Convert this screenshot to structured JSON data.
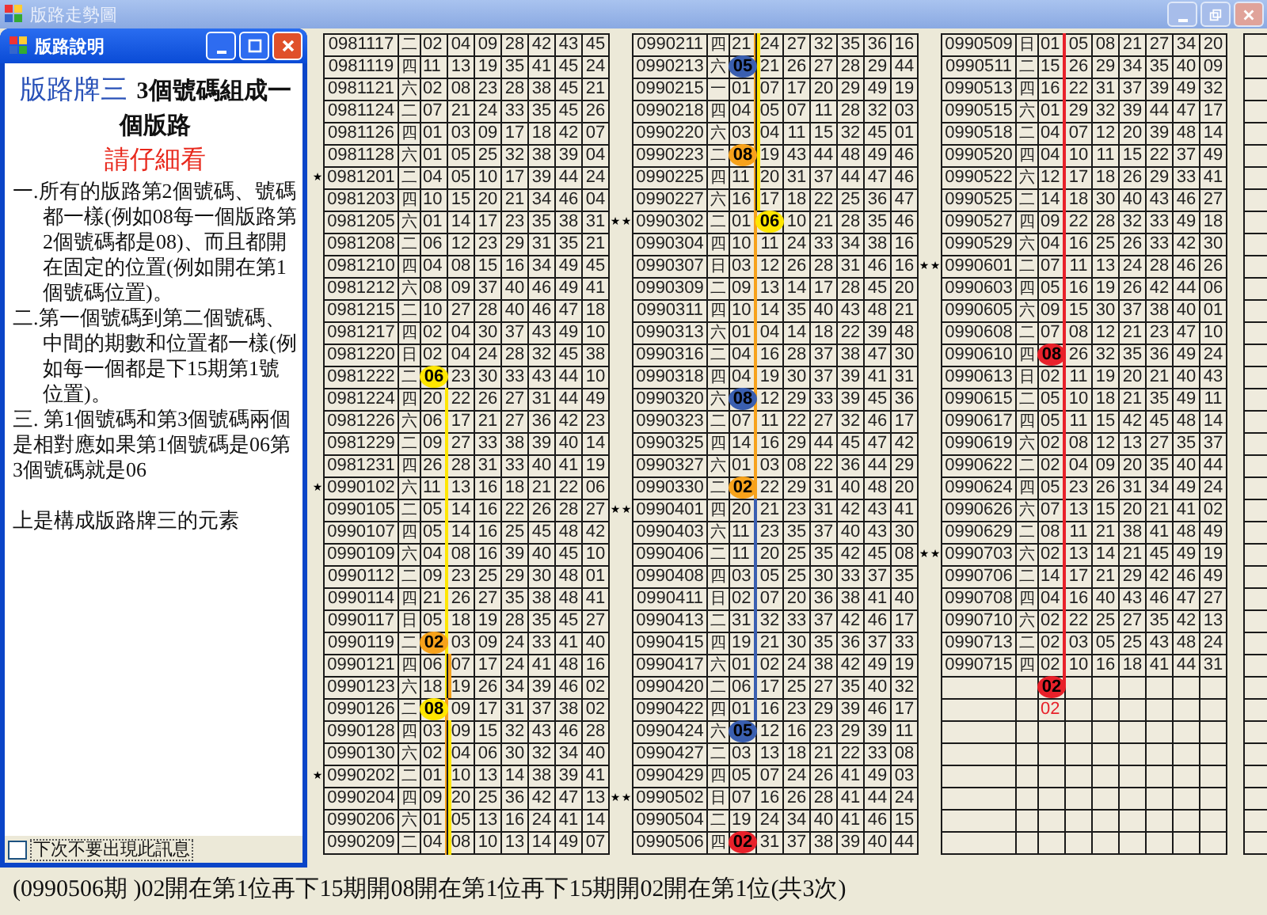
{
  "window": {
    "title": "版路走勢圖"
  },
  "dialog": {
    "title": "版路說明",
    "heading": {
      "label": "版路牌三",
      "text": "3個號碼組成一個版路"
    },
    "notice": "請仔細看",
    "paragraphs": [
      {
        "kind": "hanging",
        "text": "一.所有的版路第2個號碼、號碼都一樣(例如08每一個版路第2個號碼都是08)、而且都開在固定的位置(例如開在第1個號碼位置)。"
      },
      {
        "kind": "hanging",
        "text": "二.第一個號碼到第二個號碼、中間的期數和位置都一樣(例如每一個都是下15期第1號位置)。"
      },
      {
        "kind": "plain",
        "text": "三. 第1個號碼和第3個號碼兩個是相對應如果第1個號碼是06第3個號碼就是06"
      },
      {
        "kind": "closing",
        "text": "上是構成版路牌三的元素"
      }
    ],
    "checkbox": {
      "label": "下次不要出現此訊息",
      "checked": false
    }
  },
  "blocks": [
    {
      "rows": [
        {
          "period": "0981117",
          "day": "二",
          "numbers": [
            "02",
            "04",
            "09",
            "28",
            "42",
            "43",
            "45"
          ]
        },
        {
          "period": "0981119",
          "day": "四",
          "numbers": [
            "11",
            "13",
            "19",
            "35",
            "41",
            "45",
            "24"
          ]
        },
        {
          "period": "0981121",
          "day": "六",
          "numbers": [
            "02",
            "08",
            "23",
            "28",
            "38",
            "45",
            "21"
          ]
        },
        {
          "period": "0981124",
          "day": "二",
          "numbers": [
            "07",
            "21",
            "24",
            "33",
            "35",
            "45",
            "26"
          ]
        },
        {
          "period": "0981126",
          "day": "四",
          "numbers": [
            "01",
            "03",
            "09",
            "17",
            "18",
            "42",
            "07"
          ]
        },
        {
          "period": "0981128",
          "day": "六",
          "numbers": [
            "01",
            "05",
            "25",
            "32",
            "38",
            "39",
            "04"
          ]
        },
        {
          "period": "0981201",
          "day": "二",
          "numbers": [
            "04",
            "05",
            "10",
            "17",
            "39",
            "44",
            "24"
          ],
          "star_left": "★"
        },
        {
          "period": "0981203",
          "day": "四",
          "numbers": [
            "10",
            "15",
            "20",
            "21",
            "34",
            "46",
            "04"
          ]
        },
        {
          "period": "0981205",
          "day": "六",
          "numbers": [
            "01",
            "14",
            "17",
            "23",
            "35",
            "38",
            "31"
          ],
          "star_right": "★"
        },
        {
          "period": "0981208",
          "day": "二",
          "numbers": [
            "06",
            "12",
            "23",
            "29",
            "31",
            "35",
            "21"
          ]
        },
        {
          "period": "0981210",
          "day": "四",
          "numbers": [
            "04",
            "08",
            "15",
            "16",
            "34",
            "49",
            "45"
          ]
        },
        {
          "period": "0981212",
          "day": "六",
          "numbers": [
            "08",
            "09",
            "37",
            "40",
            "46",
            "49",
            "41"
          ]
        },
        {
          "period": "0981215",
          "day": "二",
          "numbers": [
            "10",
            "27",
            "28",
            "40",
            "46",
            "47",
            "18"
          ]
        },
        {
          "period": "0981217",
          "day": "四",
          "numbers": [
            "02",
            "04",
            "30",
            "37",
            "43",
            "49",
            "10"
          ]
        },
        {
          "period": "0981220",
          "day": "日",
          "numbers": [
            "02",
            "04",
            "24",
            "28",
            "32",
            "45",
            "38"
          ]
        },
        {
          "period": "0981222",
          "day": "二",
          "numbers": [
            {
              "text": "06",
              "color": "#ffe600"
            },
            "23",
            "30",
            "33",
            "43",
            "44",
            "10"
          ]
        },
        {
          "period": "0981224",
          "day": "四",
          "numbers": [
            "20",
            "22",
            "26",
            "27",
            "31",
            "44",
            "49"
          ],
          "traces": [
            {
              "color": "#ffe600"
            }
          ]
        },
        {
          "period": "0981226",
          "day": "六",
          "numbers": [
            "06",
            "17",
            "21",
            "27",
            "36",
            "42",
            "23"
          ],
          "traces": [
            {
              "color": "#ffe600"
            }
          ]
        },
        {
          "period": "0981229",
          "day": "二",
          "numbers": [
            "09",
            "27",
            "33",
            "38",
            "39",
            "40",
            "14"
          ],
          "traces": [
            {
              "color": "#ffe600"
            }
          ]
        },
        {
          "period": "0981231",
          "day": "四",
          "numbers": [
            "26",
            "28",
            "31",
            "33",
            "40",
            "41",
            "19"
          ],
          "traces": [
            {
              "color": "#ffe600"
            }
          ]
        },
        {
          "period": "0990102",
          "day": "六",
          "numbers": [
            "11",
            "13",
            "16",
            "18",
            "21",
            "22",
            "06"
          ],
          "star_left": "★",
          "traces": [
            {
              "color": "#ffe600"
            }
          ]
        },
        {
          "period": "0990105",
          "day": "二",
          "numbers": [
            "05",
            "14",
            "16",
            "22",
            "26",
            "28",
            "27"
          ],
          "star_right": "★",
          "traces": [
            {
              "color": "#ffe600"
            }
          ]
        },
        {
          "period": "0990107",
          "day": "四",
          "numbers": [
            "05",
            "14",
            "16",
            "25",
            "45",
            "48",
            "42"
          ],
          "traces": [
            {
              "color": "#ffe600"
            }
          ]
        },
        {
          "period": "0990109",
          "day": "六",
          "numbers": [
            "04",
            "08",
            "16",
            "39",
            "40",
            "45",
            "10"
          ],
          "traces": [
            {
              "color": "#ffe600"
            }
          ]
        },
        {
          "period": "0990112",
          "day": "二",
          "numbers": [
            "09",
            "23",
            "25",
            "29",
            "30",
            "48",
            "01"
          ],
          "traces": [
            {
              "color": "#ffe600"
            }
          ]
        },
        {
          "period": "0990114",
          "day": "四",
          "numbers": [
            "21",
            "26",
            "27",
            "35",
            "38",
            "48",
            "41"
          ],
          "traces": [
            {
              "color": "#ffe600"
            }
          ]
        },
        {
          "period": "0990117",
          "day": "日",
          "numbers": [
            "05",
            "18",
            "19",
            "28",
            "35",
            "45",
            "27"
          ],
          "traces": [
            {
              "color": "#ffe600"
            }
          ]
        },
        {
          "period": "0990119",
          "day": "二",
          "numbers": [
            {
              "text": "02",
              "color": "#f7a21b"
            },
            "03",
            "09",
            "24",
            "33",
            "41",
            "40"
          ],
          "traces": [
            {
              "color": "#ffe600"
            }
          ]
        },
        {
          "period": "0990121",
          "day": "四",
          "numbers": [
            "06",
            "07",
            "17",
            "24",
            "41",
            "48",
            "16"
          ],
          "traces": [
            {
              "color": "#ffe600"
            },
            {
              "color": "#f7a21b"
            }
          ]
        },
        {
          "period": "0990123",
          "day": "六",
          "numbers": [
            "18",
            "19",
            "26",
            "34",
            "39",
            "46",
            "02"
          ],
          "traces": [
            {
              "color": "#ffe600"
            },
            {
              "color": "#f7a21b"
            }
          ]
        },
        {
          "period": "0990126",
          "day": "二",
          "numbers": [
            {
              "text": "08",
              "color": "#ffe600"
            },
            "09",
            "17",
            "31",
            "37",
            "38",
            "02"
          ],
          "traces": [
            {
              "color": "#f7a21b"
            }
          ]
        },
        {
          "period": "0990128",
          "day": "四",
          "numbers": [
            "03",
            "09",
            "15",
            "32",
            "43",
            "46",
            "28"
          ],
          "traces": [
            {
              "color": "#f7a21b"
            },
            {
              "color": "#ffe600"
            }
          ]
        },
        {
          "period": "0990130",
          "day": "六",
          "numbers": [
            "02",
            "04",
            "06",
            "30",
            "32",
            "34",
            "40"
          ],
          "traces": [
            {
              "color": "#f7a21b"
            },
            {
              "color": "#ffe600"
            }
          ]
        },
        {
          "period": "0990202",
          "day": "二",
          "numbers": [
            "01",
            "10",
            "13",
            "14",
            "38",
            "39",
            "41"
          ],
          "star_left": "★",
          "traces": [
            {
              "color": "#f7a21b"
            },
            {
              "color": "#ffe600"
            }
          ]
        },
        {
          "period": "0990204",
          "day": "四",
          "numbers": [
            "09",
            "20",
            "25",
            "36",
            "42",
            "47",
            "13"
          ],
          "star_right": "★",
          "traces": [
            {
              "color": "#f7a21b"
            },
            {
              "color": "#ffe600"
            }
          ]
        },
        {
          "period": "0990206",
          "day": "六",
          "numbers": [
            "01",
            "05",
            "13",
            "16",
            "24",
            "41",
            "14"
          ],
          "traces": [
            {
              "color": "#f7a21b"
            },
            {
              "color": "#ffe600"
            }
          ]
        },
        {
          "period": "0990209",
          "day": "二",
          "numbers": [
            "04",
            "08",
            "10",
            "13",
            "14",
            "49",
            "07"
          ],
          "traces": [
            {
              "color": "#f7a21b"
            },
            {
              "color": "#ffe600"
            }
          ]
        }
      ]
    },
    {
      "rows": [
        {
          "period": "0990211",
          "day": "四",
          "numbers": [
            "21",
            "24",
            "27",
            "32",
            "35",
            "36",
            "16"
          ],
          "traces": [
            {
              "color": "#f7a21b"
            },
            {
              "color": "#ffe600"
            }
          ]
        },
        {
          "period": "0990213",
          "day": "六",
          "numbers": [
            {
              "text": "05",
              "color": "#3a5fb0"
            },
            "21",
            "26",
            "27",
            "28",
            "29",
            "44"
          ],
          "traces": [
            {
              "color": "#f7a21b"
            },
            {
              "color": "#ffe600"
            }
          ]
        },
        {
          "period": "0990215",
          "day": "一",
          "numbers": [
            "01",
            "07",
            "17",
            "20",
            "29",
            "49",
            "19"
          ],
          "traces": [
            {
              "color": "#f7a21b"
            },
            {
              "color": "#ffe600"
            }
          ]
        },
        {
          "period": "0990218",
          "day": "四",
          "numbers": [
            "04",
            "05",
            "07",
            "11",
            "28",
            "32",
            "03"
          ],
          "traces": [
            {
              "color": "#f7a21b"
            },
            {
              "color": "#ffe600"
            }
          ]
        },
        {
          "period": "0990220",
          "day": "六",
          "numbers": [
            "03",
            "04",
            "11",
            "15",
            "32",
            "45",
            "01"
          ],
          "traces": [
            {
              "color": "#f7a21b"
            },
            {
              "color": "#ffe600"
            }
          ]
        },
        {
          "period": "0990223",
          "day": "二",
          "numbers": [
            {
              "text": "08",
              "color": "#f7a21b"
            },
            "19",
            "43",
            "44",
            "48",
            "49",
            "46"
          ],
          "traces": [
            {
              "color": "#f7a21b"
            },
            {
              "color": "#ffe600"
            }
          ]
        },
        {
          "period": "0990225",
          "day": "四",
          "numbers": [
            "11",
            "20",
            "31",
            "37",
            "44",
            "47",
            "46"
          ],
          "traces": [
            {
              "color": "#f7a21b"
            },
            {
              "color": "#ffe600"
            }
          ]
        },
        {
          "period": "0990227",
          "day": "六",
          "numbers": [
            "16",
            "17",
            "18",
            "22",
            "25",
            "36",
            "47"
          ],
          "traces": [
            {
              "color": "#f7a21b"
            },
            {
              "color": "#ffe600"
            }
          ]
        },
        {
          "period": "0990302",
          "day": "二",
          "numbers": [
            "01",
            {
              "text": "06",
              "color": "#ffe600"
            },
            "10",
            "21",
            "28",
            "35",
            "46"
          ],
          "star_left": "★",
          "traces": [
            {
              "color": "#f7a21b"
            }
          ]
        },
        {
          "period": "0990304",
          "day": "四",
          "numbers": [
            "10",
            "11",
            "24",
            "33",
            "34",
            "38",
            "16"
          ],
          "traces": [
            {
              "color": "#f7a21b"
            }
          ]
        },
        {
          "period": "0990307",
          "day": "日",
          "numbers": [
            "03",
            "12",
            "26",
            "28",
            "31",
            "46",
            "16"
          ],
          "star_right": "★",
          "traces": [
            {
              "color": "#f7a21b"
            }
          ]
        },
        {
          "period": "0990309",
          "day": "二",
          "numbers": [
            "09",
            "13",
            "14",
            "17",
            "28",
            "45",
            "20"
          ],
          "traces": [
            {
              "color": "#f7a21b"
            }
          ]
        },
        {
          "period": "0990311",
          "day": "四",
          "numbers": [
            "10",
            "14",
            "35",
            "40",
            "43",
            "48",
            "21"
          ],
          "traces": [
            {
              "color": "#f7a21b"
            }
          ]
        },
        {
          "period": "0990313",
          "day": "六",
          "numbers": [
            "01",
            "04",
            "14",
            "18",
            "22",
            "39",
            "48"
          ],
          "traces": [
            {
              "color": "#f7a21b"
            }
          ]
        },
        {
          "period": "0990316",
          "day": "二",
          "numbers": [
            "04",
            "16",
            "28",
            "37",
            "38",
            "47",
            "30"
          ],
          "traces": [
            {
              "color": "#f7a21b"
            }
          ]
        },
        {
          "period": "0990318",
          "day": "四",
          "numbers": [
            "04",
            "19",
            "30",
            "37",
            "39",
            "41",
            "31"
          ],
          "traces": [
            {
              "color": "#f7a21b"
            }
          ]
        },
        {
          "period": "0990320",
          "day": "六",
          "numbers": [
            {
              "text": "08",
              "color": "#3a5fb0"
            },
            "12",
            "29",
            "33",
            "39",
            "45",
            "36"
          ],
          "traces": [
            {
              "color": "#f7a21b"
            }
          ]
        },
        {
          "period": "0990323",
          "day": "二",
          "numbers": [
            "07",
            "11",
            "22",
            "27",
            "32",
            "46",
            "17"
          ],
          "traces": [
            {
              "color": "#f7a21b"
            }
          ]
        },
        {
          "period": "0990325",
          "day": "四",
          "numbers": [
            "14",
            "16",
            "29",
            "44",
            "45",
            "47",
            "42"
          ],
          "traces": [
            {
              "color": "#f7a21b"
            }
          ]
        },
        {
          "period": "0990327",
          "day": "六",
          "numbers": [
            "01",
            "03",
            "08",
            "22",
            "36",
            "44",
            "29"
          ],
          "traces": [
            {
              "color": "#f7a21b"
            }
          ]
        },
        {
          "period": "0990330",
          "day": "二",
          "numbers": [
            {
              "text": "02",
              "color": "#f7a21b"
            },
            "22",
            "29",
            "31",
            "40",
            "48",
            "20"
          ],
          "traces": [
            {
              "color": "#f7a21b"
            }
          ]
        },
        {
          "period": "0990401",
          "day": "四",
          "numbers": [
            "20",
            "21",
            "23",
            "31",
            "42",
            "43",
            "41"
          ],
          "star_left": "★",
          "traces": [
            {
              "color": "#3a5fb0"
            }
          ]
        },
        {
          "period": "0990403",
          "day": "六",
          "numbers": [
            "11",
            "23",
            "35",
            "37",
            "40",
            "43",
            "30"
          ],
          "traces": [
            {
              "color": "#3a5fb0"
            }
          ]
        },
        {
          "period": "0990406",
          "day": "二",
          "numbers": [
            "11",
            "20",
            "25",
            "35",
            "42",
            "45",
            "08"
          ],
          "star_right": "★",
          "traces": [
            {
              "color": "#3a5fb0"
            }
          ]
        },
        {
          "period": "0990408",
          "day": "四",
          "numbers": [
            "03",
            "05",
            "25",
            "30",
            "33",
            "37",
            "35"
          ],
          "traces": [
            {
              "color": "#3a5fb0"
            }
          ]
        },
        {
          "period": "0990411",
          "day": "日",
          "numbers": [
            "02",
            "07",
            "20",
            "36",
            "38",
            "41",
            "40"
          ],
          "traces": [
            {
              "color": "#3a5fb0"
            }
          ]
        },
        {
          "period": "0990413",
          "day": "二",
          "numbers": [
            "31",
            "32",
            "33",
            "37",
            "42",
            "46",
            "17"
          ],
          "traces": [
            {
              "color": "#3a5fb0"
            }
          ]
        },
        {
          "period": "0990415",
          "day": "四",
          "numbers": [
            "19",
            "21",
            "30",
            "35",
            "36",
            "37",
            "33"
          ],
          "traces": [
            {
              "color": "#3a5fb0"
            }
          ]
        },
        {
          "period": "0990417",
          "day": "六",
          "numbers": [
            "01",
            "02",
            "24",
            "38",
            "42",
            "49",
            "19"
          ],
          "traces": [
            {
              "color": "#3a5fb0"
            }
          ]
        },
        {
          "period": "0990420",
          "day": "二",
          "numbers": [
            "06",
            "17",
            "25",
            "27",
            "35",
            "40",
            "32"
          ],
          "traces": [
            {
              "color": "#3a5fb0"
            }
          ]
        },
        {
          "period": "0990422",
          "day": "四",
          "numbers": [
            "01",
            "16",
            "23",
            "29",
            "39",
            "46",
            "17"
          ],
          "traces": [
            {
              "color": "#3a5fb0"
            }
          ]
        },
        {
          "period": "0990424",
          "day": "六",
          "numbers": [
            {
              "text": "05",
              "color": "#3a5fb0"
            },
            "12",
            "16",
            "23",
            "29",
            "39",
            "11"
          ]
        },
        {
          "period": "0990427",
          "day": "二",
          "numbers": [
            "03",
            "13",
            "18",
            "21",
            "22",
            "33",
            "08"
          ]
        },
        {
          "period": "0990429",
          "day": "四",
          "numbers": [
            "05",
            "07",
            "24",
            "26",
            "41",
            "49",
            "03"
          ]
        },
        {
          "period": "0990502",
          "day": "日",
          "numbers": [
            "07",
            "16",
            "26",
            "28",
            "41",
            "44",
            "24"
          ],
          "star_left": "★"
        },
        {
          "period": "0990504",
          "day": "二",
          "numbers": [
            "19",
            "24",
            "34",
            "40",
            "41",
            "46",
            "15"
          ]
        },
        {
          "period": "0990506",
          "day": "四",
          "numbers": [
            {
              "text": "02",
              "color": "#e8212a"
            },
            "31",
            "37",
            "38",
            "39",
            "40",
            "44"
          ]
        }
      ]
    },
    {
      "rows": [
        {
          "period": "0990509",
          "day": "日",
          "numbers": [
            "01",
            "05",
            "08",
            "21",
            "27",
            "34",
            "20"
          ],
          "traces": [
            {
              "color": "#e8212a"
            }
          ]
        },
        {
          "period": "0990511",
          "day": "二",
          "numbers": [
            "15",
            "26",
            "29",
            "34",
            "35",
            "40",
            "09"
          ],
          "traces": [
            {
              "color": "#e8212a"
            }
          ]
        },
        {
          "period": "0990513",
          "day": "四",
          "numbers": [
            "16",
            "22",
            "31",
            "37",
            "39",
            "49",
            "32"
          ],
          "traces": [
            {
              "color": "#e8212a"
            }
          ]
        },
        {
          "period": "0990515",
          "day": "六",
          "numbers": [
            "01",
            "29",
            "32",
            "39",
            "44",
            "47",
            "17"
          ],
          "traces": [
            {
              "color": "#e8212a"
            }
          ]
        },
        {
          "period": "0990518",
          "day": "二",
          "numbers": [
            "04",
            "07",
            "12",
            "20",
            "39",
            "48",
            "14"
          ],
          "traces": [
            {
              "color": "#e8212a"
            }
          ]
        },
        {
          "period": "0990520",
          "day": "四",
          "numbers": [
            "04",
            "10",
            "11",
            "15",
            "22",
            "37",
            "49"
          ],
          "traces": [
            {
              "color": "#e8212a"
            }
          ]
        },
        {
          "period": "0990522",
          "day": "六",
          "numbers": [
            "12",
            "17",
            "18",
            "26",
            "29",
            "33",
            "41"
          ],
          "traces": [
            {
              "color": "#e8212a"
            }
          ]
        },
        {
          "period": "0990525",
          "day": "二",
          "numbers": [
            "14",
            "18",
            "30",
            "40",
            "43",
            "46",
            "27"
          ],
          "traces": [
            {
              "color": "#e8212a"
            }
          ]
        },
        {
          "period": "0990527",
          "day": "四",
          "numbers": [
            "09",
            "22",
            "28",
            "32",
            "33",
            "49",
            "18"
          ],
          "traces": [
            {
              "color": "#e8212a"
            }
          ]
        },
        {
          "period": "0990529",
          "day": "六",
          "numbers": [
            "04",
            "16",
            "25",
            "26",
            "33",
            "42",
            "30"
          ],
          "traces": [
            {
              "color": "#e8212a"
            }
          ]
        },
        {
          "period": "0990601",
          "day": "二",
          "numbers": [
            "07",
            "11",
            "13",
            "24",
            "28",
            "46",
            "26"
          ],
          "star_left": "★",
          "traces": [
            {
              "color": "#e8212a"
            }
          ]
        },
        {
          "period": "0990603",
          "day": "四",
          "numbers": [
            "05",
            "16",
            "19",
            "26",
            "42",
            "44",
            "06"
          ],
          "traces": [
            {
              "color": "#e8212a"
            }
          ]
        },
        {
          "period": "0990605",
          "day": "六",
          "numbers": [
            "09",
            "15",
            "30",
            "37",
            "38",
            "40",
            "01"
          ],
          "traces": [
            {
              "color": "#e8212a"
            }
          ]
        },
        {
          "period": "0990608",
          "day": "二",
          "numbers": [
            "07",
            "08",
            "12",
            "21",
            "23",
            "47",
            "10"
          ],
          "traces": [
            {
              "color": "#e8212a"
            }
          ]
        },
        {
          "period": "0990610",
          "day": "四",
          "numbers": [
            {
              "text": "08",
              "color": "#e8212a"
            },
            "26",
            "32",
            "35",
            "36",
            "49",
            "24"
          ],
          "traces": [
            {
              "color": "#e8212a"
            }
          ]
        },
        {
          "period": "0990613",
          "day": "日",
          "numbers": [
            "02",
            "11",
            "19",
            "20",
            "21",
            "40",
            "43"
          ],
          "traces": [
            {
              "color": "#e8212a"
            }
          ]
        },
        {
          "period": "0990615",
          "day": "二",
          "numbers": [
            "05",
            "10",
            "18",
            "21",
            "35",
            "49",
            "11"
          ],
          "traces": [
            {
              "color": "#e8212a"
            }
          ]
        },
        {
          "period": "0990617",
          "day": "四",
          "numbers": [
            "05",
            "11",
            "15",
            "42",
            "45",
            "48",
            "14"
          ],
          "traces": [
            {
              "color": "#e8212a"
            }
          ]
        },
        {
          "period": "0990619",
          "day": "六",
          "numbers": [
            "02",
            "08",
            "12",
            "13",
            "27",
            "35",
            "37"
          ],
          "traces": [
            {
              "color": "#e8212a"
            }
          ]
        },
        {
          "period": "0990622",
          "day": "二",
          "numbers": [
            "02",
            "04",
            "09",
            "20",
            "35",
            "40",
            "44"
          ],
          "traces": [
            {
              "color": "#e8212a"
            }
          ]
        },
        {
          "period": "0990624",
          "day": "四",
          "numbers": [
            "05",
            "23",
            "26",
            "31",
            "34",
            "49",
            "24"
          ],
          "traces": [
            {
              "color": "#e8212a"
            }
          ]
        },
        {
          "period": "0990626",
          "day": "六",
          "numbers": [
            "07",
            "13",
            "15",
            "20",
            "21",
            "41",
            "02"
          ],
          "traces": [
            {
              "color": "#e8212a"
            }
          ]
        },
        {
          "period": "0990629",
          "day": "二",
          "numbers": [
            "08",
            "11",
            "21",
            "38",
            "41",
            "48",
            "49"
          ],
          "traces": [
            {
              "color": "#e8212a"
            }
          ]
        },
        {
          "period": "0990703",
          "day": "六",
          "numbers": [
            "02",
            "13",
            "14",
            "21",
            "45",
            "49",
            "19"
          ],
          "star_left": "★",
          "traces": [
            {
              "color": "#e8212a"
            }
          ]
        },
        {
          "period": "0990706",
          "day": "二",
          "numbers": [
            "14",
            "17",
            "21",
            "29",
            "42",
            "46",
            "49"
          ],
          "traces": [
            {
              "color": "#e8212a"
            }
          ]
        },
        {
          "period": "0990708",
          "day": "四",
          "numbers": [
            "04",
            "16",
            "40",
            "43",
            "46",
            "47",
            "27"
          ],
          "traces": [
            {
              "color": "#e8212a"
            }
          ]
        },
        {
          "period": "0990710",
          "day": "六",
          "numbers": [
            "02",
            "22",
            "25",
            "27",
            "35",
            "42",
            "13"
          ],
          "traces": [
            {
              "color": "#e8212a"
            }
          ]
        },
        {
          "period": "0990713",
          "day": "二",
          "numbers": [
            "02",
            "03",
            "05",
            "25",
            "43",
            "48",
            "24"
          ],
          "traces": [
            {
              "color": "#e8212a"
            }
          ]
        },
        {
          "period": "0990715",
          "day": "四",
          "numbers": [
            "02",
            "10",
            "16",
            "18",
            "41",
            "44",
            "31"
          ],
          "traces": [
            {
              "color": "#e8212a"
            }
          ]
        }
      ],
      "extra_rows": [
        {
          "kind": "forecast",
          "number": "02",
          "color": "#e8212a",
          "traces": [
            {
              "color": "#e8212a"
            }
          ]
        },
        {
          "kind": "note",
          "number": "02",
          "color": "#e8212a"
        }
      ]
    }
  ],
  "status": "(0990506期 )02開在第1位再下15期開08開在第1位再下15期開02開在第1位(共3次)"
}
